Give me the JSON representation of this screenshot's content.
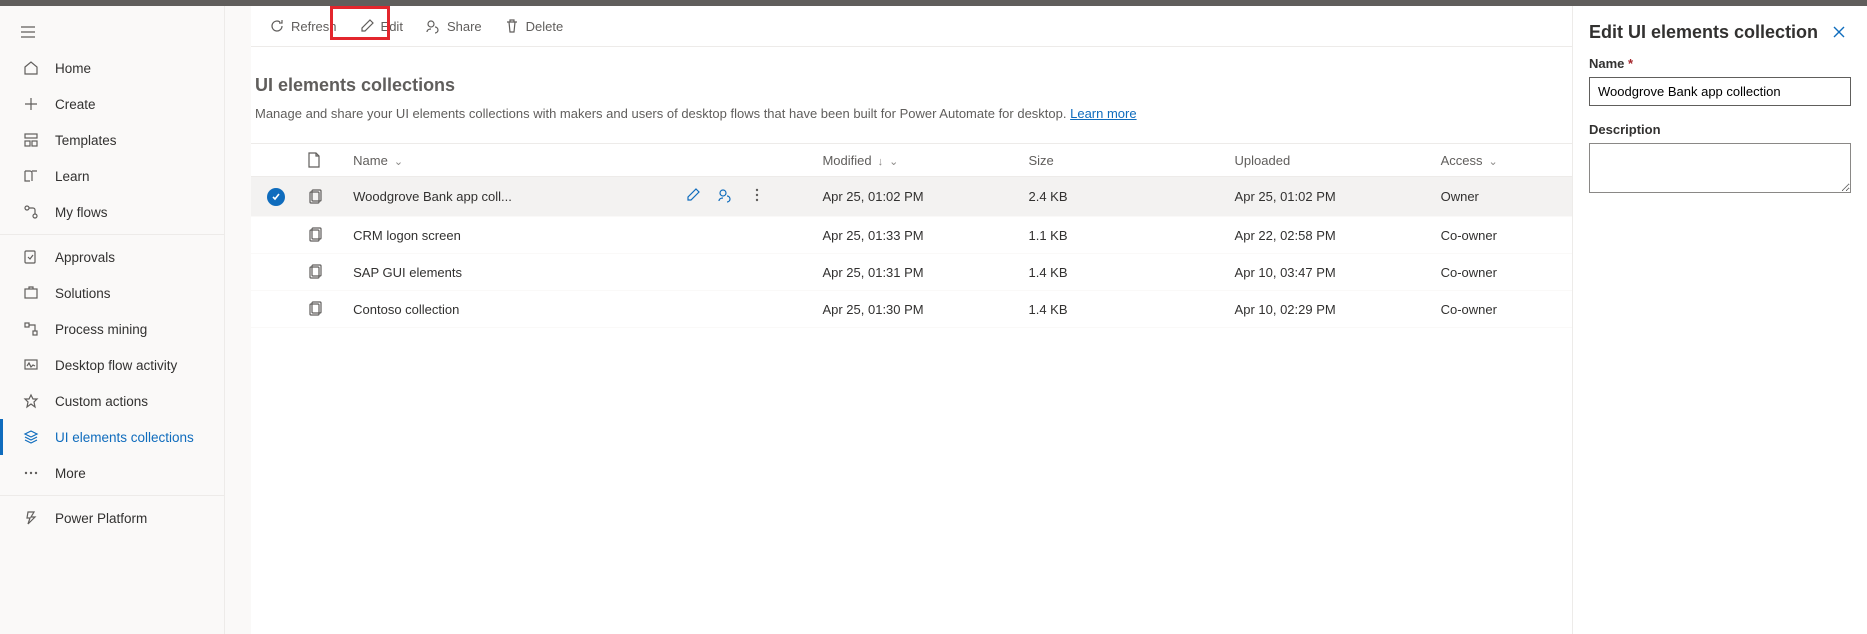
{
  "sidebar": {
    "items": [
      {
        "label": "Home"
      },
      {
        "label": "Create"
      },
      {
        "label": "Templates"
      },
      {
        "label": "Learn"
      },
      {
        "label": "My flows"
      },
      {
        "label": "Approvals"
      },
      {
        "label": "Solutions"
      },
      {
        "label": "Process mining"
      },
      {
        "label": "Desktop flow activity"
      },
      {
        "label": "Custom actions"
      },
      {
        "label": "UI elements collections"
      },
      {
        "label": "More"
      },
      {
        "label": "Power Platform"
      }
    ]
  },
  "toolbar": {
    "refresh": "Refresh",
    "edit": "Edit",
    "share": "Share",
    "delete": "Delete"
  },
  "page": {
    "title": "UI elements collections",
    "description": "Manage and share your UI elements collections with makers and users of desktop flows that have been built for Power Automate for desktop. ",
    "learn_more": "Learn more"
  },
  "table": {
    "headers": {
      "name": "Name",
      "modified": "Modified",
      "size": "Size",
      "uploaded": "Uploaded",
      "access": "Access"
    },
    "rows": [
      {
        "name": "Woodgrove Bank app coll...",
        "modified": "Apr 25, 01:02 PM",
        "size": "2.4 KB",
        "uploaded": "Apr 25, 01:02 PM",
        "access": "Owner",
        "selected": true
      },
      {
        "name": "CRM logon screen",
        "modified": "Apr 25, 01:33 PM",
        "size": "1.1 KB",
        "uploaded": "Apr 22, 02:58 PM",
        "access": "Co-owner",
        "selected": false
      },
      {
        "name": "SAP GUI elements",
        "modified": "Apr 25, 01:31 PM",
        "size": "1.4 KB",
        "uploaded": "Apr 10, 03:47 PM",
        "access": "Co-owner",
        "selected": false
      },
      {
        "name": "Contoso collection",
        "modified": "Apr 25, 01:30 PM",
        "size": "1.4 KB",
        "uploaded": "Apr 10, 02:29 PM",
        "access": "Co-owner",
        "selected": false
      }
    ]
  },
  "panel": {
    "title": "Edit UI elements collection",
    "name_label": "Name",
    "name_value": "Woodgrove Bank app collection",
    "desc_label": "Description",
    "desc_value": ""
  }
}
